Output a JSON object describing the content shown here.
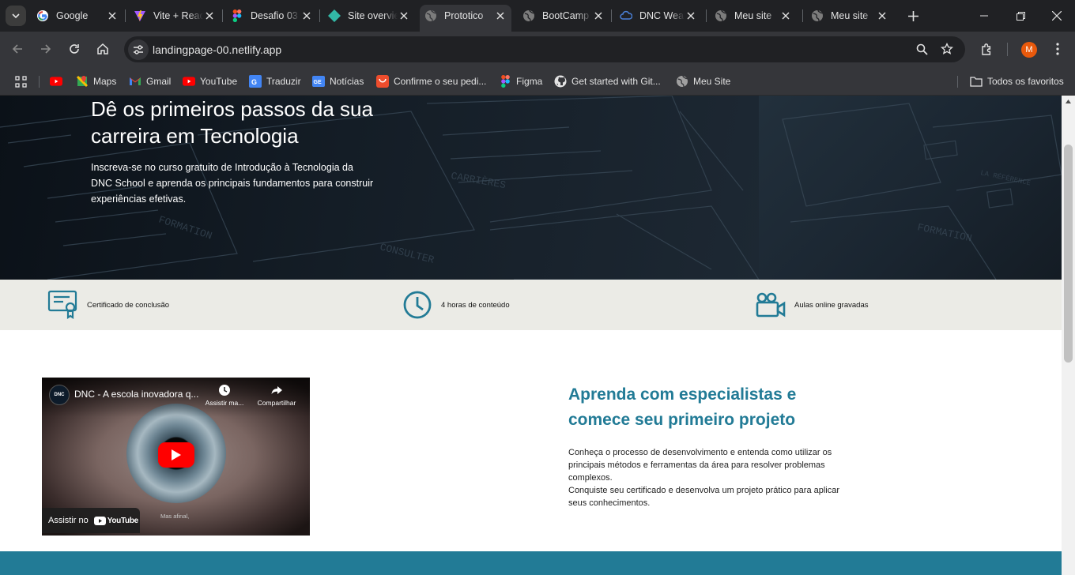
{
  "browser": {
    "tabs": [
      {
        "title": "Google",
        "icon": "google-icon"
      },
      {
        "title": "Vite + React",
        "icon": "vite-icon"
      },
      {
        "title": "Desafio 03",
        "icon": "figma-icon"
      },
      {
        "title": "Site overview",
        "icon": "netlify-icon"
      },
      {
        "title": "Prototico",
        "icon": "globe-icon",
        "active": true
      },
      {
        "title": "BootCamp",
        "icon": "globe-icon"
      },
      {
        "title": "DNC Weather",
        "icon": "cloud-icon"
      },
      {
        "title": "Meu site",
        "icon": "globe-icon"
      },
      {
        "title": "Meu site",
        "icon": "globe-icon"
      }
    ],
    "url": "landingpage-00.netlify.app",
    "profile_initial": "M",
    "bookmarks": [
      {
        "label": "",
        "icon": "youtube-icon"
      },
      {
        "label": "Maps",
        "icon": "maps-icon"
      },
      {
        "label": "Gmail",
        "icon": "gmail-icon"
      },
      {
        "label": "YouTube",
        "icon": "youtube-icon"
      },
      {
        "label": "Traduzir",
        "icon": "translate-icon"
      },
      {
        "label": "Notícias",
        "icon": "news-icon"
      },
      {
        "label": "Confirme o seu pedi...",
        "icon": "shop-icon"
      },
      {
        "label": "Figma",
        "icon": "figma-icon"
      },
      {
        "label": "Get started with Git...",
        "icon": "github-icon"
      },
      {
        "label": "Meu Site",
        "icon": "globe-icon"
      }
    ],
    "all_bookmarks_label": "Todos os favoritos"
  },
  "hero": {
    "title": "Dê os primeiros passos da sua carreira em Tecnologia",
    "subtitle": "Inscreva-se no curso gratuito de Introdução à Tecnologia da DNC School e aprenda os principais fundamentos para construir experiências efetivas."
  },
  "features": [
    {
      "label": "Certificado de conclusão",
      "icon": "certificate-icon"
    },
    {
      "label": "4 horas de conteúdo",
      "icon": "clock-icon"
    },
    {
      "label": "Aulas online gravadas",
      "icon": "video-camera-icon"
    }
  ],
  "video": {
    "channel_badge": "DNC",
    "title": "DNC - A escola inovadora q...",
    "watch_later": "Assistir ma...",
    "share": "Compartilhar",
    "watch_on": "Assistir no",
    "youtube": "YouTube",
    "caption": "Mas afinal,"
  },
  "learn": {
    "heading": "Aprenda com especialistas e comece seu primeiro projeto",
    "body": "Conheça o processo de desenvolvimento e entenda como utilizar os principais métodos e ferramentas da área para resolver problemas complexos.\nConquiste seu certificado e desenvolva um projeto prático para aplicar seus conhecimentos."
  },
  "colors": {
    "accent": "#227b96",
    "features_bg": "#ebebe6",
    "chrome_dark": "#202124",
    "chrome_mid": "#35363a"
  }
}
